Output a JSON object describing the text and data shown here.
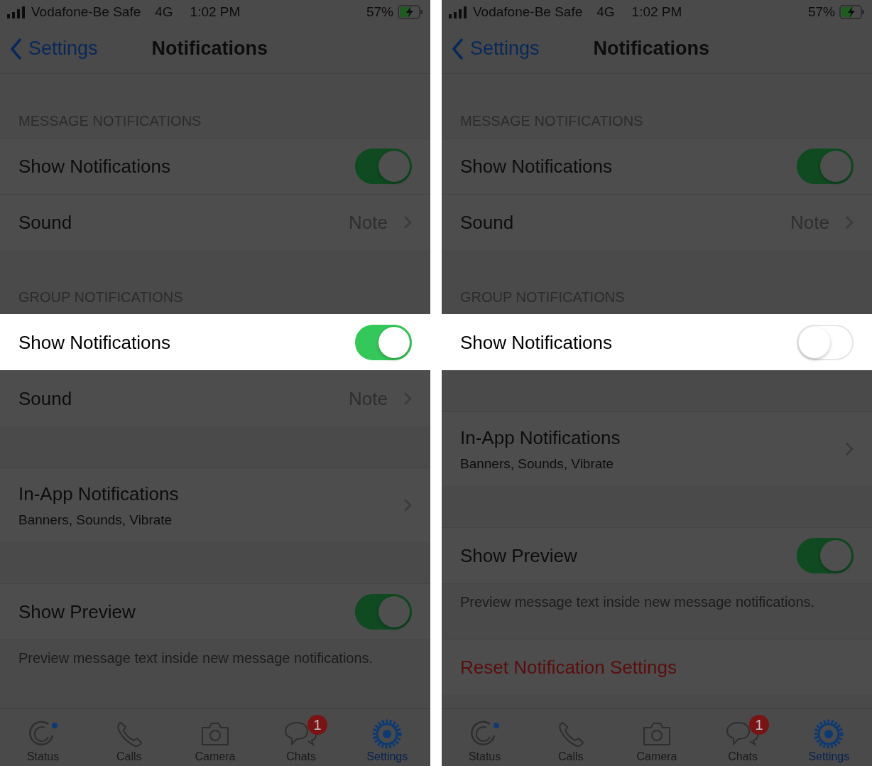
{
  "screens": [
    {
      "status_bar": {
        "carrier": "Vodafone-Be Safe",
        "network": "4G",
        "time": "1:02 PM",
        "battery": "57%"
      },
      "nav": {
        "back": "Settings",
        "title": "Notifications"
      },
      "sections": [
        {
          "header": "MESSAGE NOTIFICATIONS",
          "rows": [
            {
              "kind": "toggle",
              "title": "Show Notifications",
              "on": true,
              "highlighted": false
            },
            {
              "kind": "value",
              "title": "Sound",
              "value": "Note",
              "highlighted": false
            }
          ]
        },
        {
          "header": "GROUP NOTIFICATIONS",
          "rows": [
            {
              "kind": "toggle",
              "title": "Show Notifications",
              "on": true,
              "highlighted": true
            },
            {
              "kind": "value",
              "title": "Sound",
              "value": "Note",
              "highlighted": false
            }
          ]
        },
        {
          "rows": [
            {
              "kind": "detail",
              "title": "In-App Notifications",
              "subtitle": "Banners, Sounds, Vibrate",
              "highlighted": false
            }
          ]
        },
        {
          "rows": [
            {
              "kind": "toggle",
              "title": "Show Preview",
              "on": true,
              "highlighted": false
            }
          ],
          "footer": "Preview message text inside new message notifications."
        }
      ],
      "tabs": [
        {
          "kind": "status",
          "label": "Status",
          "selected": false
        },
        {
          "kind": "calls",
          "label": "Calls",
          "selected": false
        },
        {
          "kind": "camera",
          "label": "Camera",
          "selected": false
        },
        {
          "kind": "chats",
          "label": "Chats",
          "selected": false,
          "badge": "1"
        },
        {
          "kind": "settings",
          "label": "Settings",
          "selected": true
        }
      ]
    },
    {
      "status_bar": {
        "carrier": "Vodafone-Be Safe",
        "network": "4G",
        "time": "1:02 PM",
        "battery": "57%"
      },
      "nav": {
        "back": "Settings",
        "title": "Notifications"
      },
      "sections": [
        {
          "header": "MESSAGE NOTIFICATIONS",
          "rows": [
            {
              "kind": "toggle",
              "title": "Show Notifications",
              "on": true,
              "highlighted": false
            },
            {
              "kind": "value",
              "title": "Sound",
              "value": "Note",
              "highlighted": false
            }
          ]
        },
        {
          "header": "GROUP NOTIFICATIONS",
          "rows": [
            {
              "kind": "toggle",
              "title": "Show Notifications",
              "on": false,
              "highlighted": true
            }
          ]
        },
        {
          "rows": [
            {
              "kind": "detail",
              "title": "In-App Notifications",
              "subtitle": "Banners, Sounds, Vibrate",
              "highlighted": false
            }
          ]
        },
        {
          "rows": [
            {
              "kind": "toggle",
              "title": "Show Preview",
              "on": true,
              "highlighted": false
            }
          ],
          "footer": "Preview message text inside new message notifications."
        },
        {
          "rows": [
            {
              "kind": "action",
              "title": "Reset Notification Settings",
              "highlighted": false
            }
          ]
        }
      ],
      "tabs": [
        {
          "kind": "status",
          "label": "Status",
          "selected": false
        },
        {
          "kind": "calls",
          "label": "Calls",
          "selected": false
        },
        {
          "kind": "camera",
          "label": "Camera",
          "selected": false
        },
        {
          "kind": "chats",
          "label": "Chats",
          "selected": false,
          "badge": "1"
        },
        {
          "kind": "settings",
          "label": "Settings",
          "selected": true
        }
      ]
    }
  ]
}
